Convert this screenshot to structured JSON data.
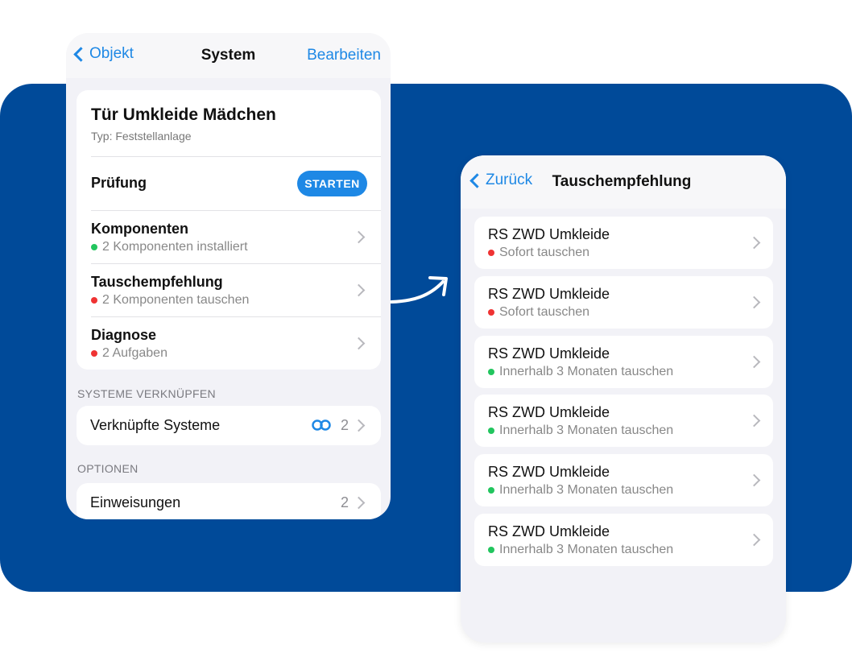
{
  "colors": {
    "brand_band": "#004a99",
    "accent": "#1e88e5",
    "status_ok": "#22c55e",
    "status_alert": "#ef3333"
  },
  "left_screen": {
    "nav": {
      "back_label": "Objekt",
      "title": "System",
      "action_label": "Bearbeiten"
    },
    "system": {
      "name": "Tür Umkleide Mädchen",
      "type": "Typ: Feststellanlage"
    },
    "rows": [
      {
        "label": "Prüfung",
        "button": "STARTEN"
      },
      {
        "label": "Komponenten",
        "status": "2 Komponenten installiert",
        "status_color": "green"
      },
      {
        "label": "Tauschempfehlung",
        "status": "2 Komponenten tauschen",
        "status_color": "red"
      },
      {
        "label": "Diagnose",
        "status": "2 Aufgaben",
        "status_color": "red"
      }
    ],
    "section_link": {
      "header": "SYSTEME VERKNÜPFEN",
      "label": "Verknüpfte Systeme",
      "count": "2",
      "icon": "link-icon"
    },
    "section_options": {
      "header": "OPTIONEN",
      "label": "Einweisungen",
      "count": "2"
    }
  },
  "right_screen": {
    "nav": {
      "back_label": "Zurück",
      "title": "Tauschempfehlung"
    },
    "items": [
      {
        "title": "RS ZWD Umkleide",
        "status": "Sofort tauschen",
        "status_color": "red"
      },
      {
        "title": "RS ZWD Umkleide",
        "status": "Sofort tauschen",
        "status_color": "red"
      },
      {
        "title": "RS ZWD Umkleide",
        "status": "Innerhalb 3 Monaten tauschen",
        "status_color": "green"
      },
      {
        "title": "RS ZWD Umkleide",
        "status": "Innerhalb 3 Monaten tauschen",
        "status_color": "green"
      },
      {
        "title": "RS ZWD Umkleide",
        "status": "Innerhalb 3 Monaten tauschen",
        "status_color": "green"
      },
      {
        "title": "RS ZWD Umkleide",
        "status": "Innerhalb 3 Monaten tauschen",
        "status_color": "green"
      }
    ]
  }
}
